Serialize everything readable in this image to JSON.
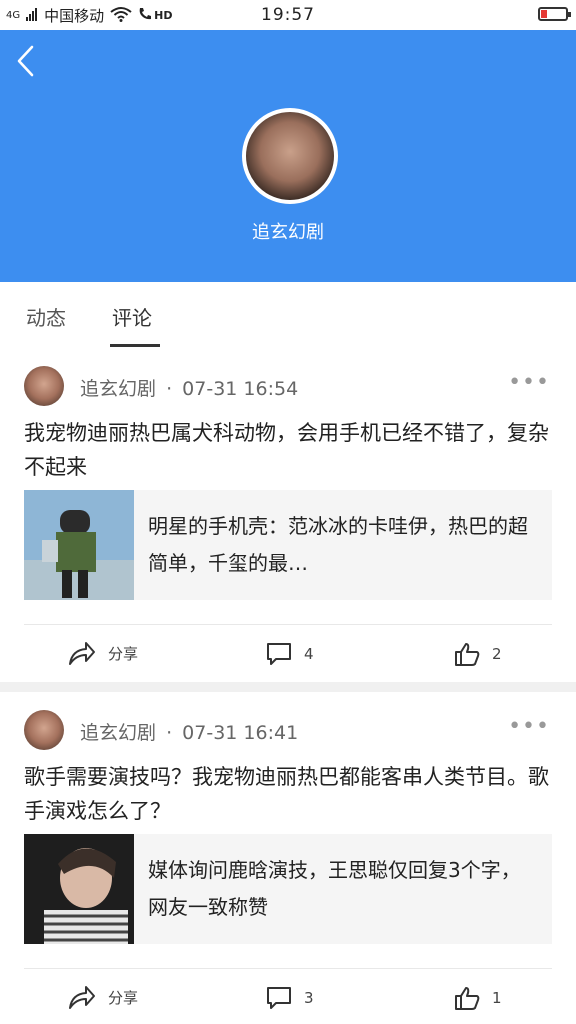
{
  "status_bar": {
    "network": "4G",
    "carrier": "中国移动",
    "hd": "HD",
    "time": "19:57"
  },
  "header": {
    "name": "追玄幻剧",
    "accent": "#3d8ef0"
  },
  "tabs": [
    {
      "label": "动态",
      "active": false
    },
    {
      "label": "评论",
      "active": true
    }
  ],
  "posts": [
    {
      "author": "追玄幻剧",
      "meta_sep": "·",
      "time": "07-31 16:54",
      "text": "我宠物迪丽热巴属犬科动物，会用手机已经不错了，复杂不起来",
      "card_title": "明星的手机壳：范冰冰的卡哇伊，热巴的超简单，千玺的最…",
      "share_label": "分享",
      "comment_count": "4",
      "like_count": "2"
    },
    {
      "author": "追玄幻剧",
      "meta_sep": "·",
      "time": "07-31 16:41",
      "text": "歌手需要演技吗？我宠物迪丽热巴都能客串人类节目。歌手演戏怎么了？",
      "card_title": "媒体询问鹿晗演技，王思聪仅回复3个字，网友一致称赞",
      "share_label": "分享",
      "comment_count": "3",
      "like_count": "1"
    }
  ]
}
